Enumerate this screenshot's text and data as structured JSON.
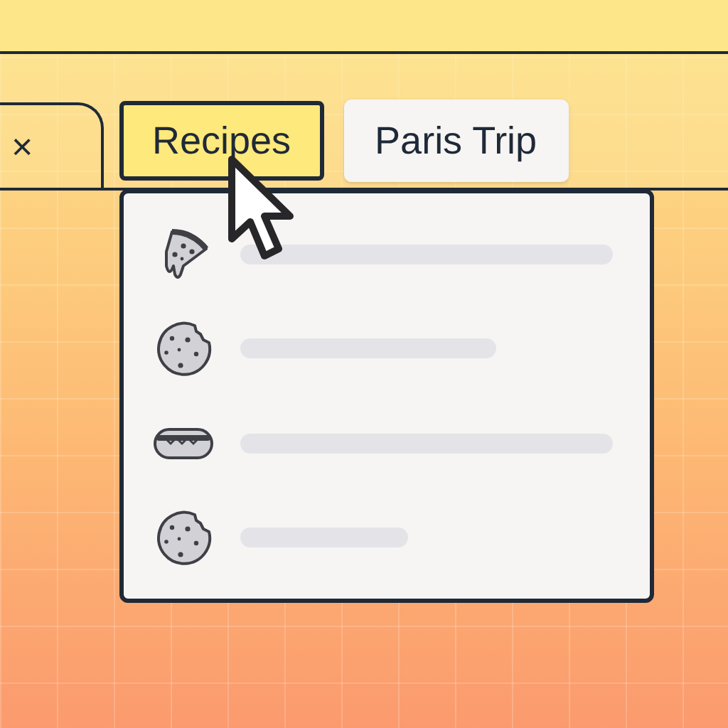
{
  "open_tab": {
    "close_label": "×"
  },
  "tab_groups": [
    {
      "label": "Recipes",
      "selected": true
    },
    {
      "label": "Paris Trip",
      "selected": false
    }
  ],
  "group_menu": {
    "items": [
      {
        "kind": "pizza"
      },
      {
        "kind": "cookie"
      },
      {
        "kind": "hotdog"
      },
      {
        "kind": "cookie"
      }
    ]
  }
}
